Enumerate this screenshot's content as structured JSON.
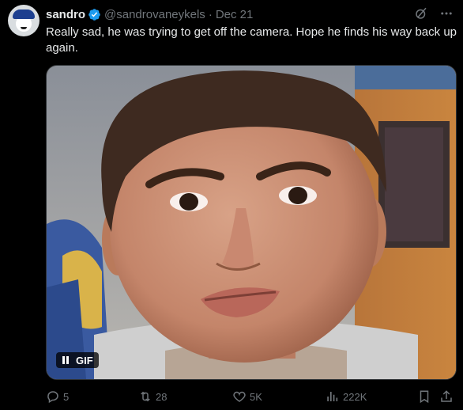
{
  "author": {
    "name": "sandro",
    "handle": "@sandrovaneykels",
    "separator": "·",
    "date": "Dec 21"
  },
  "tweet_text": "Really sad, he was trying to get off the camera. Hope he finds his way back up again.",
  "media": {
    "badge": "GIF",
    "play_state": "paused"
  },
  "actions": {
    "replies": "5",
    "reposts": "28",
    "likes": "5K",
    "views": "222K"
  },
  "icons": {
    "verified": "verified-badge-icon",
    "grok": "grok-icon",
    "more": "more-icon",
    "reply": "reply-icon",
    "repost": "repost-icon",
    "like": "heart-icon",
    "views": "views-icon",
    "bookmark": "bookmark-icon",
    "share": "share-icon"
  },
  "colors": {
    "background": "#000000",
    "text": "#e7e9ea",
    "muted": "#71767b",
    "verified": "#1d9bf0"
  }
}
